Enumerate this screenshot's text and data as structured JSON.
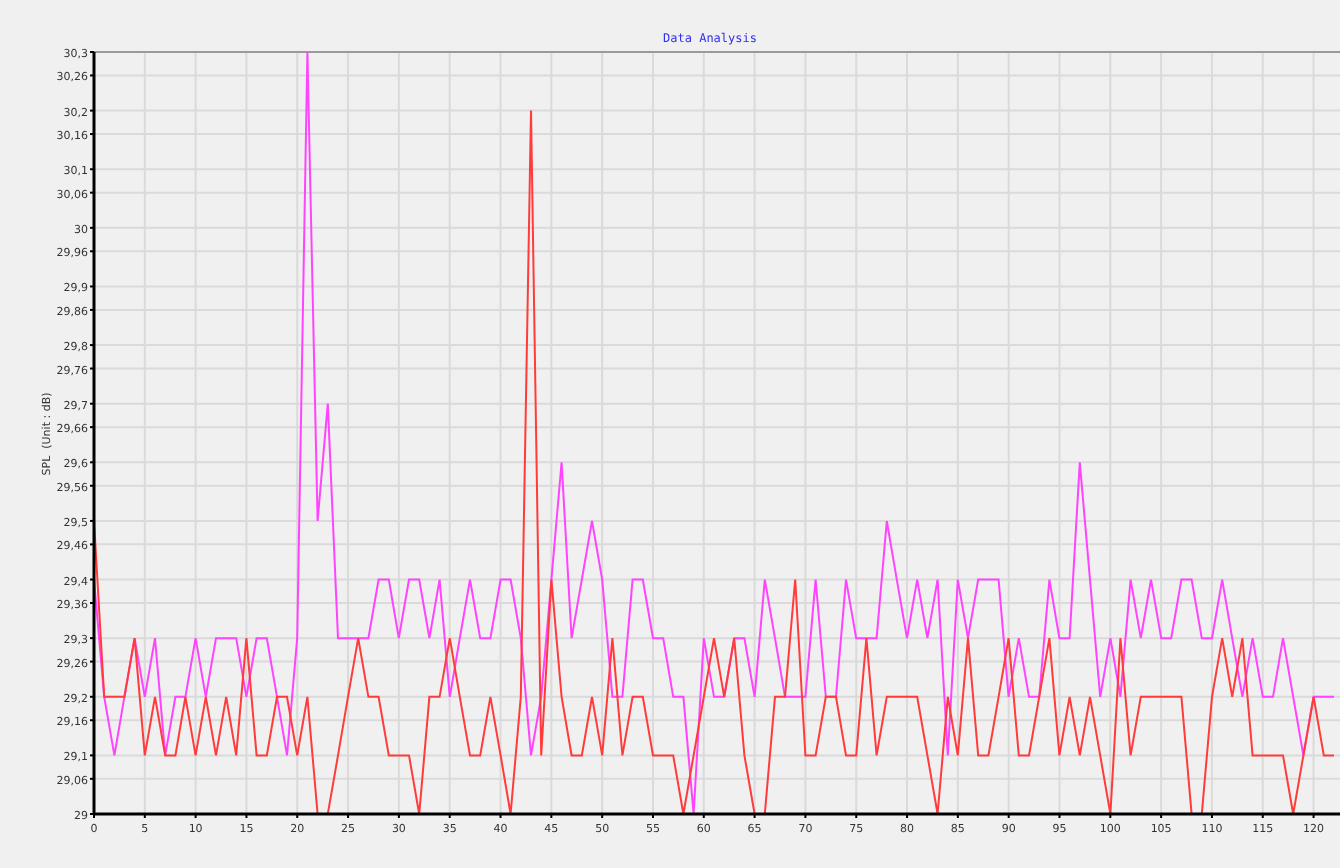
{
  "chart": {
    "chart_data": {
      "type": "line",
      "title": "Data Analysis",
      "ylabel": "SPL  (Unit : dB)",
      "x": [
        0,
        1,
        2,
        3,
        4,
        5,
        6,
        7,
        8,
        9,
        10,
        11,
        12,
        13,
        14,
        15,
        16,
        17,
        18,
        19,
        20,
        21,
        22,
        23,
        24,
        25,
        26,
        27,
        28,
        29,
        30,
        31,
        32,
        33,
        34,
        35,
        36,
        37,
        38,
        39,
        40,
        41,
        42,
        43,
        44,
        45,
        46,
        47,
        48,
        49,
        50,
        51,
        52,
        53,
        54,
        55,
        56,
        57,
        58,
        59,
        60,
        61,
        62,
        63,
        64,
        65,
        66,
        67,
        68,
        69,
        70,
        71,
        72,
        73,
        74,
        75,
        76,
        77,
        78,
        79,
        80,
        81,
        82,
        83,
        84,
        85,
        86,
        87,
        88,
        89,
        90,
        91,
        92,
        93,
        94,
        95,
        96,
        97,
        98,
        99,
        100,
        101,
        102,
        103,
        104,
        105,
        106,
        107,
        108,
        109,
        110,
        111,
        112,
        113,
        114,
        115,
        116,
        117,
        118,
        119,
        120,
        121,
        122
      ],
      "series": [
        {
          "color": "#ff44ff",
          "values": [
            29.4,
            29.2,
            29.1,
            29.2,
            29.3,
            29.2,
            29.3,
            29.1,
            29.2,
            29.2,
            29.3,
            29.2,
            29.3,
            29.3,
            29.3,
            29.2,
            29.3,
            29.3,
            29.2,
            29.1,
            29.3,
            30.3,
            29.5,
            29.7,
            29.3,
            29.3,
            29.3,
            29.3,
            29.4,
            29.4,
            29.3,
            29.4,
            29.4,
            29.3,
            29.4,
            29.2,
            29.3,
            29.4,
            29.3,
            29.3,
            29.4,
            29.4,
            29.3,
            29.1,
            29.2,
            29.4,
            29.6,
            29.3,
            29.4,
            29.5,
            29.4,
            29.2,
            29.2,
            29.4,
            29.4,
            29.3,
            29.3,
            29.2,
            29.2,
            29.0,
            29.3,
            29.2,
            29.2,
            29.3,
            29.3,
            29.2,
            29.4,
            29.3,
            29.2,
            29.2,
            29.2,
            29.4,
            29.2,
            29.2,
            29.4,
            29.3,
            29.3,
            29.3,
            29.5,
            29.4,
            29.3,
            29.4,
            29.3,
            29.4,
            29.1,
            29.4,
            29.3,
            29.4,
            29.4,
            29.4,
            29.2,
            29.3,
            29.2,
            29.2,
            29.4,
            29.3,
            29.3,
            29.6,
            29.4,
            29.2,
            29.3,
            29.2,
            29.4,
            29.3,
            29.4,
            29.3,
            29.3,
            29.4,
            29.4,
            29.3,
            29.3,
            29.4,
            29.3,
            29.2,
            29.3,
            29.2,
            29.2,
            29.3,
            29.2,
            29.1,
            29.2,
            29.2,
            29.2
          ]
        },
        {
          "color": "#ff3b3b",
          "values": [
            29.5,
            29.2,
            29.2,
            29.2,
            29.3,
            29.1,
            29.2,
            29.1,
            29.1,
            29.2,
            29.1,
            29.2,
            29.1,
            29.2,
            29.1,
            29.3,
            29.1,
            29.1,
            29.2,
            29.2,
            29.1,
            29.2,
            29.0,
            29.0,
            29.1,
            29.2,
            29.3,
            29.2,
            29.2,
            29.1,
            29.1,
            29.1,
            29.0,
            29.2,
            29.2,
            29.3,
            29.2,
            29.1,
            29.1,
            29.2,
            29.1,
            29.0,
            29.2,
            30.2,
            29.1,
            29.4,
            29.2,
            29.1,
            29.1,
            29.2,
            29.1,
            29.3,
            29.1,
            29.2,
            29.2,
            29.1,
            29.1,
            29.1,
            29.0,
            29.1,
            29.2,
            29.3,
            29.2,
            29.3,
            29.1,
            29.0,
            29.0,
            29.2,
            29.2,
            29.4,
            29.1,
            29.1,
            29.2,
            29.2,
            29.1,
            29.1,
            29.3,
            29.1,
            29.2,
            29.2,
            29.2,
            29.2,
            29.1,
            29.0,
            29.2,
            29.1,
            29.3,
            29.1,
            29.1,
            29.2,
            29.3,
            29.1,
            29.1,
            29.2,
            29.3,
            29.1,
            29.2,
            29.1,
            29.2,
            29.1,
            29.0,
            29.3,
            29.1,
            29.2,
            29.2,
            29.2,
            29.2,
            29.2,
            29.0,
            29.0,
            29.2,
            29.3,
            29.2,
            29.3,
            29.1,
            29.1,
            29.1,
            29.1,
            29.0,
            29.1,
            29.2,
            29.1,
            29.1
          ]
        }
      ],
      "xlim": [
        0,
        122.6
      ],
      "ylim": [
        29,
        30.3
      ],
      "grid": true,
      "xticks": [
        0,
        5,
        10,
        15,
        20,
        25,
        30,
        35,
        40,
        45,
        50,
        55,
        60,
        65,
        70,
        75,
        80,
        85,
        90,
        95,
        100,
        105,
        110,
        115,
        120
      ],
      "yticks": [
        {
          "value": 29,
          "label": "29"
        },
        {
          "value": 29.06,
          "label": "29,06"
        },
        {
          "value": 29.1,
          "label": "29,1"
        },
        {
          "value": 29.16,
          "label": "29,16"
        },
        {
          "value": 29.2,
          "label": "29,2"
        },
        {
          "value": 29.26,
          "label": "29,26"
        },
        {
          "value": 29.3,
          "label": "29,3"
        },
        {
          "value": 29.36,
          "label": "29,36"
        },
        {
          "value": 29.4,
          "label": "29,4"
        },
        {
          "value": 29.46,
          "label": "29,46"
        },
        {
          "value": 29.5,
          "label": "29,5"
        },
        {
          "value": 29.56,
          "label": "29,56"
        },
        {
          "value": 29.6,
          "label": "29,6"
        },
        {
          "value": 29.66,
          "label": "29,66"
        },
        {
          "value": 29.7,
          "label": "29,7"
        },
        {
          "value": 29.76,
          "label": "29,76"
        },
        {
          "value": 29.8,
          "label": "29,8"
        },
        {
          "value": 29.86,
          "label": "29,86"
        },
        {
          "value": 29.9,
          "label": "29,9"
        },
        {
          "value": 29.96,
          "label": "29,96"
        },
        {
          "value": 30,
          "label": "30"
        },
        {
          "value": 30.06,
          "label": "30,06"
        },
        {
          "value": 30.1,
          "label": "30,1"
        },
        {
          "value": 30.16,
          "label": "30,16"
        },
        {
          "value": 30.2,
          "label": "30,2"
        },
        {
          "value": 30.26,
          "label": "30,26"
        },
        {
          "value": 30.3,
          "label": "30,3"
        }
      ]
    }
  }
}
